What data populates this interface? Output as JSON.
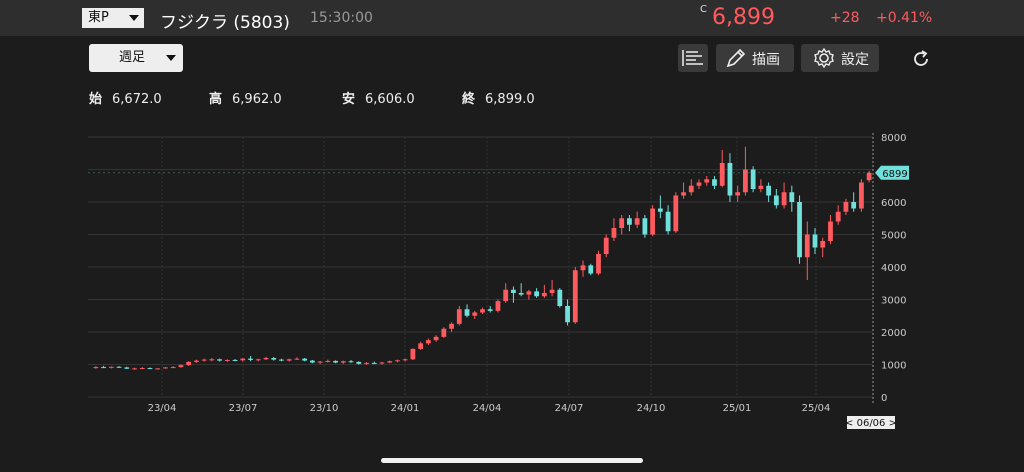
{
  "header": {
    "market": "東P",
    "title": "フジクラ (5803)",
    "time": "15:30:00",
    "c_mark": "C",
    "price": "6,899",
    "change": "+28",
    "change_pct": "+0.41%"
  },
  "toolbar": {
    "period": "週足",
    "draw_label": "描画",
    "settings_label": "設定"
  },
  "ohlc": [
    {
      "key": "始",
      "value": "6,672.0"
    },
    {
      "key": "高",
      "value": "6,962.0"
    },
    {
      "key": "安",
      "value": "6,606.0"
    },
    {
      "key": "終",
      "value": "6,899.0"
    }
  ],
  "colors": {
    "up": "#ff5a5f",
    "down": "#6fe0dc",
    "bg": "#1c1c1c"
  },
  "chart_data": {
    "type": "candlestick",
    "interval": "weekly",
    "x_ticks": [
      "23/04",
      "23/07",
      "23/10",
      "24/01",
      "24/04",
      "24/07",
      "24/10",
      "25/01",
      "25/04"
    ],
    "y_ticks": [
      0,
      1000,
      2000,
      3000,
      4000,
      5000,
      6000,
      7000,
      8000
    ],
    "ylim": [
      0,
      8000
    ],
    "last_price_label": "6899",
    "date_label": "< 06/06 >",
    "grid": true,
    "candles": [
      [
        900,
        950,
        870,
        920
      ],
      [
        920,
        960,
        890,
        910
      ],
      [
        910,
        940,
        880,
        930
      ],
      [
        930,
        950,
        900,
        910
      ],
      [
        910,
        930,
        860,
        870
      ],
      [
        870,
        900,
        840,
        880
      ],
      [
        880,
        920,
        860,
        890
      ],
      [
        890,
        910,
        860,
        870
      ],
      [
        870,
        890,
        850,
        880
      ],
      [
        880,
        920,
        870,
        910
      ],
      [
        910,
        950,
        900,
        920
      ],
      [
        920,
        1000,
        900,
        980
      ],
      [
        980,
        1100,
        960,
        1080
      ],
      [
        1080,
        1150,
        1050,
        1120
      ],
      [
        1120,
        1180,
        1090,
        1150
      ],
      [
        1150,
        1200,
        1100,
        1160
      ],
      [
        1160,
        1180,
        1090,
        1120
      ],
      [
        1120,
        1160,
        1080,
        1140
      ],
      [
        1140,
        1170,
        1100,
        1130
      ],
      [
        1130,
        1200,
        1090,
        1180
      ],
      [
        1180,
        1260,
        1100,
        1140
      ],
      [
        1140,
        1180,
        1100,
        1160
      ],
      [
        1160,
        1240,
        1140,
        1200
      ],
      [
        1200,
        1230,
        1120,
        1150
      ],
      [
        1150,
        1180,
        1100,
        1120
      ],
      [
        1120,
        1180,
        1090,
        1160
      ],
      [
        1160,
        1220,
        1140,
        1180
      ],
      [
        1180,
        1200,
        1100,
        1120
      ],
      [
        1120,
        1140,
        1040,
        1060
      ],
      [
        1060,
        1110,
        1020,
        1090
      ],
      [
        1090,
        1150,
        1060,
        1110
      ],
      [
        1110,
        1130,
        1040,
        1060
      ],
      [
        1060,
        1120,
        1020,
        1100
      ],
      [
        1100,
        1140,
        1050,
        1080
      ],
      [
        1080,
        1100,
        1000,
        1020
      ],
      [
        1020,
        1070,
        990,
        1050
      ],
      [
        1050,
        1090,
        1010,
        1030
      ],
      [
        1030,
        1080,
        1000,
        1060
      ],
      [
        1060,
        1120,
        1040,
        1100
      ],
      [
        1100,
        1150,
        1070,
        1130
      ],
      [
        1130,
        1180,
        1100,
        1160
      ],
      [
        1160,
        1500,
        1140,
        1480
      ],
      [
        1480,
        1700,
        1450,
        1650
      ],
      [
        1650,
        1800,
        1600,
        1750
      ],
      [
        1750,
        1900,
        1700,
        1850
      ],
      [
        1850,
        2150,
        1820,
        2100
      ],
      [
        2100,
        2300,
        2000,
        2250
      ],
      [
        2250,
        2800,
        2200,
        2700
      ],
      [
        2700,
        2850,
        2450,
        2500
      ],
      [
        2500,
        2650,
        2400,
        2600
      ],
      [
        2600,
        2750,
        2550,
        2700
      ],
      [
        2700,
        2800,
        2600,
        2650
      ],
      [
        2650,
        3000,
        2600,
        2950
      ],
      [
        2950,
        3500,
        2900,
        3300
      ],
      [
        3300,
        3400,
        2900,
        3200
      ],
      [
        3200,
        3500,
        3100,
        3150
      ],
      [
        3150,
        3300,
        3000,
        3250
      ],
      [
        3250,
        3350,
        3050,
        3100
      ],
      [
        3100,
        3450,
        3050,
        3200
      ],
      [
        3200,
        3600,
        3100,
        3300
      ],
      [
        3300,
        3350,
        2750,
        2800
      ],
      [
        2800,
        3000,
        2200,
        2300
      ],
      [
        2300,
        4000,
        2250,
        3900
      ],
      [
        3900,
        4200,
        3700,
        4050
      ],
      [
        4050,
        4100,
        3750,
        3800
      ],
      [
        3800,
        4500,
        3750,
        4400
      ],
      [
        4400,
        5000,
        4300,
        4900
      ],
      [
        4900,
        5500,
        4800,
        5200
      ],
      [
        5200,
        5600,
        5000,
        5500
      ],
      [
        5500,
        5600,
        5100,
        5300
      ],
      [
        5300,
        5700,
        5200,
        5500
      ],
      [
        5500,
        5600,
        4900,
        5000
      ],
      [
        5000,
        5900,
        4950,
        5800
      ],
      [
        5800,
        6200,
        5500,
        5700
      ],
      [
        5700,
        5900,
        5000,
        5100
      ],
      [
        5100,
        6300,
        5050,
        6200
      ],
      [
        6200,
        6600,
        6100,
        6300
      ],
      [
        6300,
        6700,
        6200,
        6500
      ],
      [
        6500,
        6700,
        6400,
        6600
      ],
      [
        6600,
        6800,
        6500,
        6700
      ],
      [
        6700,
        6800,
        6400,
        6500
      ],
      [
        6500,
        7600,
        6450,
        7200
      ],
      [
        7200,
        7500,
        6000,
        6200
      ],
      [
        6200,
        6500,
        6000,
        6300
      ],
      [
        6300,
        7700,
        6200,
        7000
      ],
      [
        7000,
        7100,
        6300,
        6400
      ],
      [
        6400,
        6700,
        6300,
        6500
      ],
      [
        6500,
        6600,
        6000,
        6200
      ],
      [
        6200,
        6400,
        5800,
        5900
      ],
      [
        5900,
        6600,
        5800,
        6300
      ],
      [
        6300,
        6500,
        5700,
        6000
      ],
      [
        6000,
        6200,
        4100,
        4300
      ],
      [
        4300,
        5400,
        3600,
        5000
      ],
      [
        5000,
        5200,
        4400,
        4600
      ],
      [
        4600,
        4900,
        4300,
        4800
      ],
      [
        4800,
        5600,
        4700,
        5400
      ],
      [
        5400,
        5900,
        5300,
        5700
      ],
      [
        5700,
        6100,
        5600,
        6000
      ],
      [
        6000,
        6300,
        5700,
        5800
      ],
      [
        5800,
        6700,
        5700,
        6600
      ],
      [
        6672,
        6962,
        6606,
        6899
      ]
    ]
  }
}
